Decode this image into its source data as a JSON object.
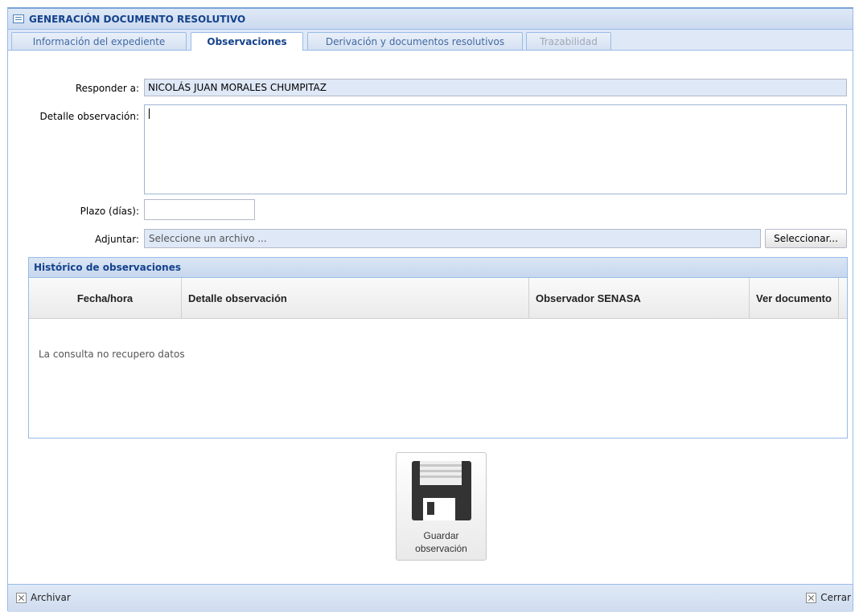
{
  "window": {
    "title": "GENERACIÓN DOCUMENTO RESOLUTIVO"
  },
  "tabs": [
    {
      "label": "Información del expediente",
      "state": "normal"
    },
    {
      "label": "Observaciones",
      "state": "active"
    },
    {
      "label": "Derivación y documentos resolutivos",
      "state": "normal"
    },
    {
      "label": "Trazabilidad",
      "state": "disabled"
    }
  ],
  "form": {
    "responder_label": "Responder a:",
    "responder_value": "NICOLÁS JUAN MORALES CHUMPITAZ",
    "detalle_label": "Detalle observación:",
    "detalle_value": "",
    "plazo_label": "Plazo (días):",
    "plazo_value": "",
    "adjuntar_label": "Adjuntar:",
    "adjuntar_placeholder": "Seleccione un archivo ...",
    "seleccionar_label": "Seleccionar..."
  },
  "history": {
    "title": "Histórico de observaciones",
    "columns": [
      "Fecha/hora",
      "Detalle observación",
      "Observador SENASA",
      "Ver documento"
    ],
    "empty_text": "La consulta no recupero datos"
  },
  "save_button": {
    "line1": "Guardar",
    "line2": "observación",
    "icon": "floppy-disk-icon"
  },
  "footer": {
    "archivar": "Archivar",
    "cerrar": "Cerrar"
  },
  "colors": {
    "header_text": "#15428b",
    "border": "#99bbe8",
    "tab_bg": "#dfe8f6"
  }
}
